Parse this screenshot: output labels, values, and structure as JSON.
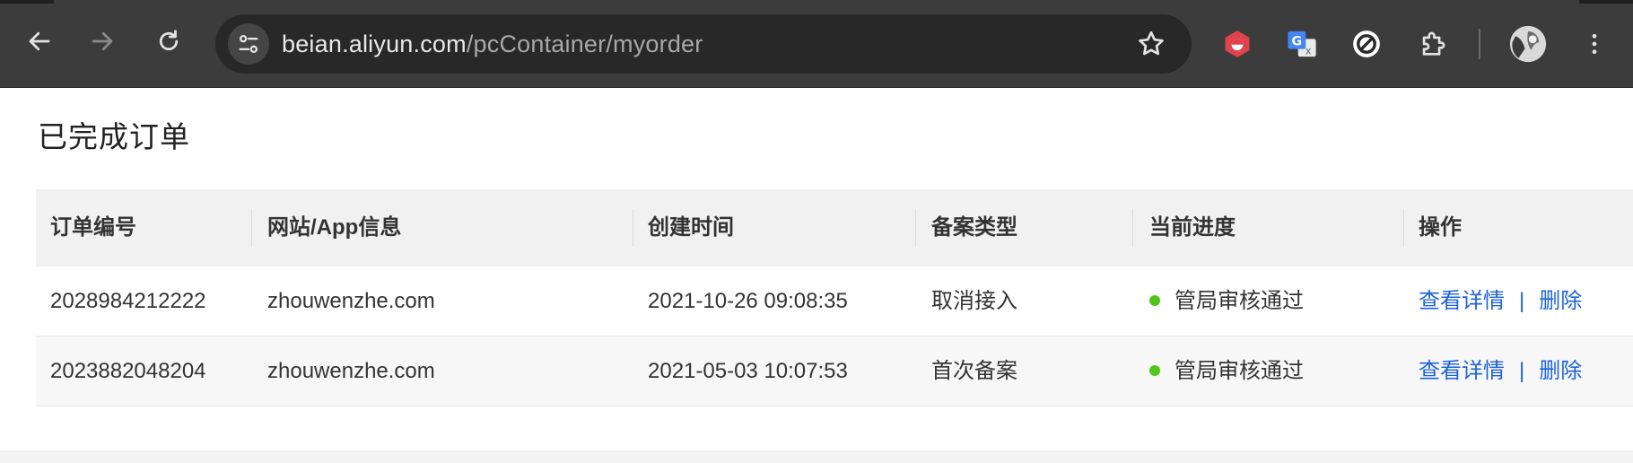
{
  "browser": {
    "url_host": "beian.aliyun.com",
    "url_path": "/pcContainer/myorder"
  },
  "page": {
    "title": "已完成订单"
  },
  "table": {
    "columns": [
      "订单编号",
      "网站/App信息",
      "创建时间",
      "备案类型",
      "当前进度",
      "操作"
    ],
    "rows": [
      {
        "order_no": "2028984212222",
        "site": "zhouwenzhe.com",
        "created": "2021-10-26 09:08:35",
        "type": "取消接入",
        "status": "管局审核通过",
        "actions": {
          "detail": "查看详情",
          "separator": "|",
          "delete": "删除"
        }
      },
      {
        "order_no": "2023882048204",
        "site": "zhouwenzhe.com",
        "created": "2021-05-03 10:07:53",
        "type": "首次备案",
        "status": "管局审核通过",
        "actions": {
          "detail": "查看详情",
          "separator": "|",
          "delete": "删除"
        }
      }
    ]
  },
  "colors": {
    "link": "#1e63d6",
    "status_ok": "#52c41a",
    "chrome_bg": "#3c3c3c"
  },
  "icons": [
    "back-icon",
    "forward-icon",
    "reload-icon",
    "site-settings-icon",
    "bookmark-star-icon",
    "extension-red-icon",
    "google-translate-icon",
    "block-icon",
    "puzzle-extensions-icon",
    "profile-avatar",
    "more-menu-icon"
  ]
}
